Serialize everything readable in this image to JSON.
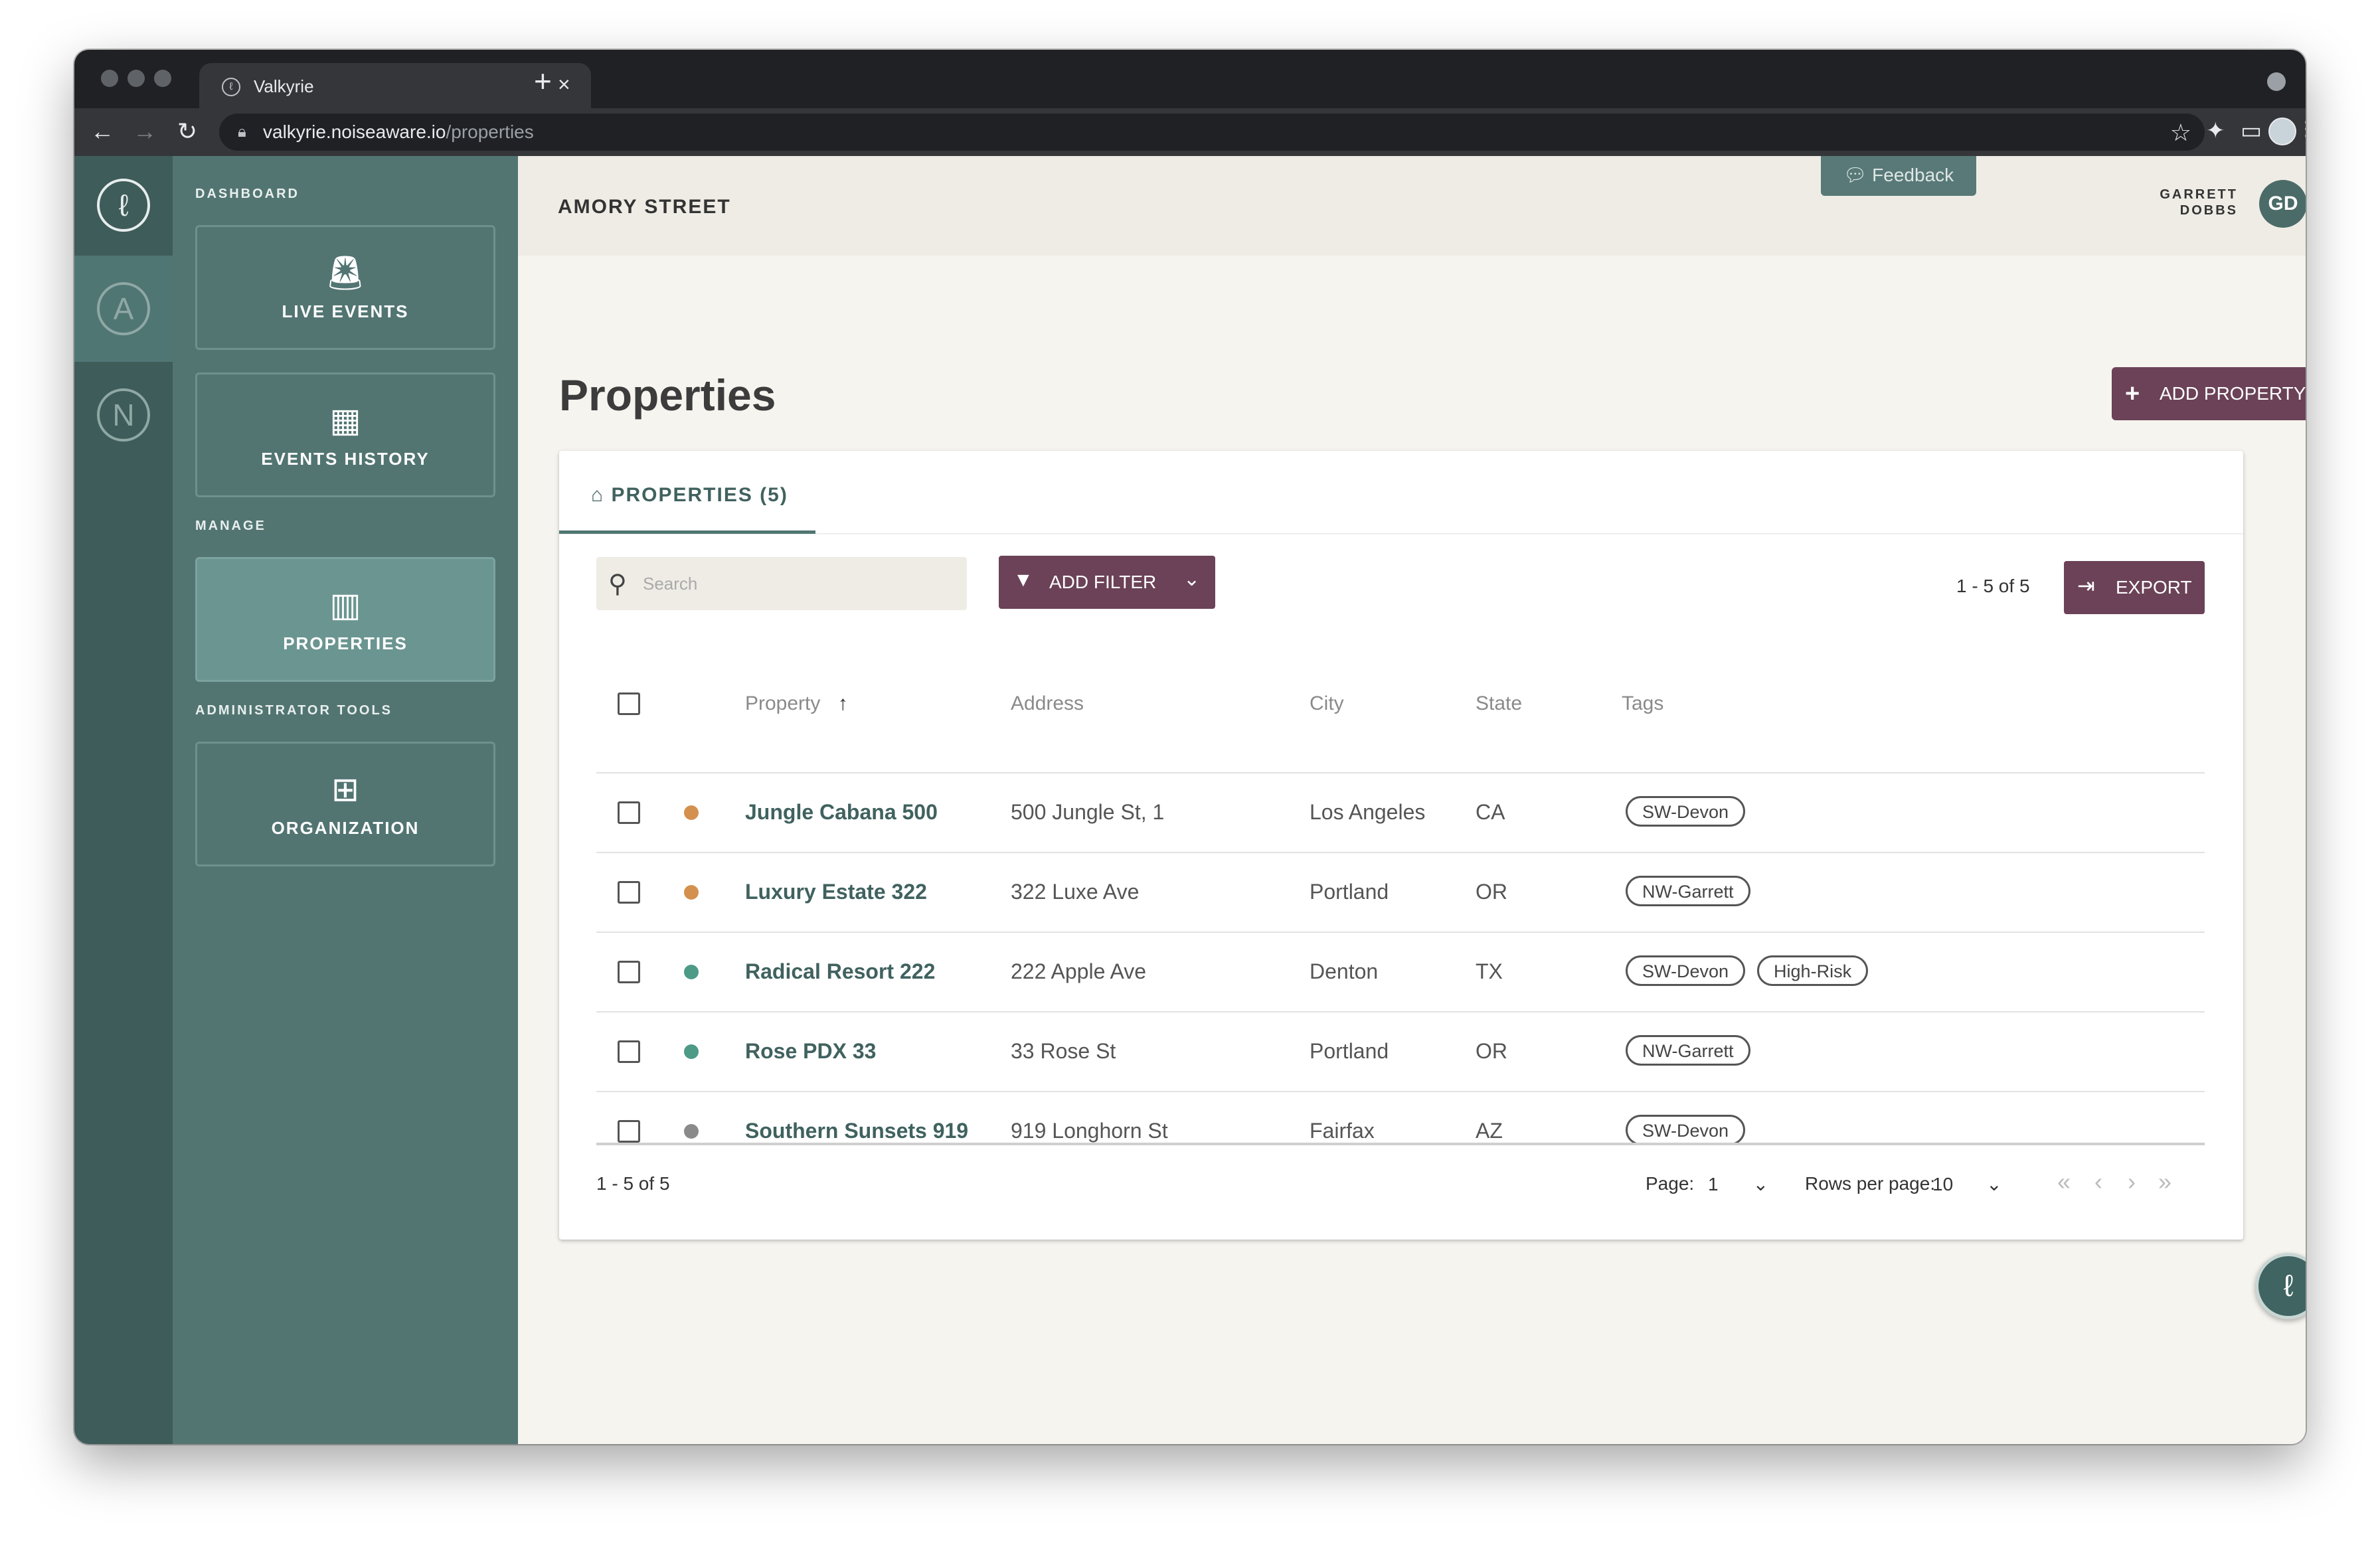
{
  "browser": {
    "tab_title": "Valkyrie",
    "url_host": "valkyrie.noiseaware.io",
    "url_path": "/properties"
  },
  "rail": {
    "items": [
      {
        "icon": "noiseaware-logo-icon"
      },
      {
        "letter": "A"
      },
      {
        "letter": "N"
      }
    ]
  },
  "sidebar": {
    "sections": {
      "dashboard": "DASHBOARD",
      "manage": "MANAGE",
      "admin": "ADMINISTRATOR TOOLS"
    },
    "items": [
      {
        "label": "LIVE EVENTS",
        "icon": "siren-icon"
      },
      {
        "label": "EVENTS HISTORY",
        "icon": "calendar-icon"
      },
      {
        "label": "PROPERTIES",
        "icon": "building-icon",
        "active": true
      },
      {
        "label": "ORGANIZATION",
        "icon": "org-chart-icon"
      }
    ]
  },
  "header": {
    "location": "AMORY STREET",
    "feedback": "Feedback",
    "user_first": "GARRETT",
    "user_last": "DOBBS",
    "initials": "GD"
  },
  "page": {
    "title": "Properties",
    "add_button": "ADD PROPERTY"
  },
  "card": {
    "tab_label": "PROPERTIES (5)",
    "search_placeholder": "Search",
    "filter_button": "ADD FILTER",
    "count": "1 - 5 of 5",
    "export_button": "EXPORT"
  },
  "table": {
    "columns": [
      "Property",
      "Address",
      "City",
      "State",
      "Tags"
    ],
    "sort_indicator": "↑",
    "rows": [
      {
        "name": "Jungle Cabana 500",
        "address": "500 Jungle St, 1",
        "city": "Los Angeles",
        "state": "CA",
        "tags": [
          "SW-Devon"
        ],
        "status_color": "#d4904e"
      },
      {
        "name": "Luxury Estate 322",
        "address": "322 Luxe Ave",
        "city": "Portland",
        "state": "OR",
        "tags": [
          "NW-Garrett"
        ],
        "status_color": "#d4904e"
      },
      {
        "name": "Radical Resort 222",
        "address": "222 Apple Ave",
        "city": "Denton",
        "state": "TX",
        "tags": [
          "SW-Devon",
          "High-Risk"
        ],
        "status_color": "#4d9a86"
      },
      {
        "name": "Rose PDX 33",
        "address": "33 Rose St",
        "city": "Portland",
        "state": "OR",
        "tags": [
          "NW-Garrett"
        ],
        "status_color": "#4d9a86"
      },
      {
        "name": "Southern Sunsets 919",
        "address": "919 Longhorn St",
        "city": "Fairfax",
        "state": "AZ",
        "tags": [
          "SW-Devon"
        ],
        "status_color": "#8a8a8a"
      }
    ]
  },
  "footer": {
    "count": "1 - 5 of 5",
    "page_label": "Page:",
    "page_value": "1",
    "rows_label": "Rows per page:",
    "rows_value": "10"
  },
  "colors": {
    "accent": "#6b4257",
    "sidebar": "#527572",
    "rail": "#3e5c59"
  }
}
